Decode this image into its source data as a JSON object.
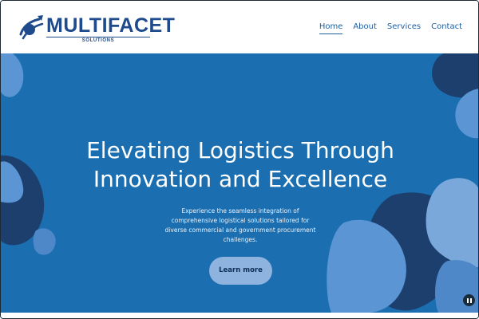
{
  "logo": {
    "name": "MULTIFACET",
    "tagline": "SOLUTIONS"
  },
  "nav": {
    "items": [
      {
        "label": "Home",
        "active": true
      },
      {
        "label": "About",
        "active": false
      },
      {
        "label": "Services",
        "active": false
      },
      {
        "label": "Contact",
        "active": false
      }
    ]
  },
  "hero": {
    "title_line1": "Elevating Logistics Through",
    "title_line2": "Innovation and Excellence",
    "description": "Experience the seamless integration of comprehensive logistical solutions tailored for diverse commercial and government procurement challenges.",
    "cta_label": "Learn more"
  },
  "colors": {
    "brand": "#1f4b8c",
    "hero_background": "#1b6fb1",
    "cta_background": "#8fb3df",
    "blob_dark": "#1d3f6e",
    "blob_light": "#5b95d3"
  },
  "icons": {
    "logo_mark": "rocket-swoosh-icon",
    "pause": "pause-icon"
  }
}
